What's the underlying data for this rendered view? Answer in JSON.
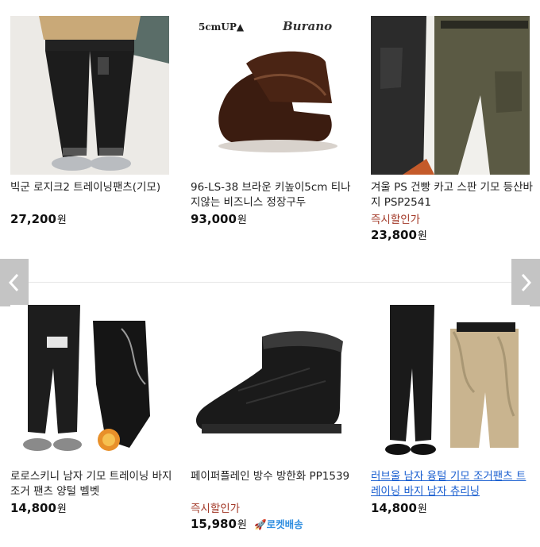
{
  "products": [
    {
      "title": "빅군 로지크2 트레이닝팬츠(기모)",
      "sale": "",
      "price": "27,200",
      "won": "원",
      "rocket": ""
    },
    {
      "title": "96-LS-38 브라운 키높이5cm 티나지않는 비즈니스 정장구두",
      "sale": "",
      "price": "93,000",
      "won": "원",
      "rocket": ""
    },
    {
      "title": "겨울 PS 건빵 카고 스판 기모 등산바지 PSP2541",
      "sale": "즉시할인가",
      "price": "23,800",
      "won": "원",
      "rocket": ""
    },
    {
      "title": "로로스키니 남자 기모 트레이닝 바지 조거 팬츠 양털 벨벳",
      "sale": "",
      "price": "14,800",
      "won": "원",
      "rocket": ""
    },
    {
      "title": "페이퍼플레인 방수 방한화 PP1539",
      "sale": "즉시할인가",
      "price": "15,980",
      "won": "원",
      "rocket": "로켓배송"
    },
    {
      "title": "러브울 남자 융털 기모 조거팬츠 트레이닝 바지 남자 츄리닝",
      "sale": "",
      "price": "14,800",
      "won": "원",
      "rocket": ""
    }
  ],
  "image_labels": {
    "brand_badge": "5cmUP▲",
    "brand_logo": "Burano"
  },
  "colors": {
    "sale": "#a43b2a",
    "link": "#1a5fd0",
    "rocket": "#2f8ee0",
    "arrow_bg": "#c4c4c4"
  },
  "icons": {
    "prev": "chevron-left-icon",
    "next": "chevron-right-icon",
    "rocket": "rocket-icon"
  }
}
